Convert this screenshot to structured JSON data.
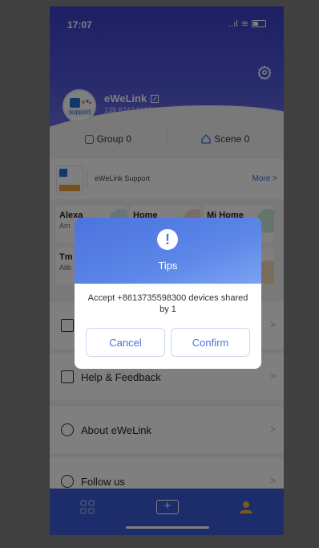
{
  "status": {
    "time": "17:07",
    "signal": "..ıl",
    "wifi": "≋"
  },
  "profile": {
    "name": "eWeLink",
    "phone": "139 6747 9150",
    "avatar_text": "support"
  },
  "group_scene": {
    "group_label": "Group 0",
    "scene_label": "Scene 0"
  },
  "support": {
    "name": "eWeLink Support",
    "more_label": "More >"
  },
  "cards": [
    {
      "title": "Alexa",
      "subtitle": "Am"
    },
    {
      "title": "Home",
      "subtitle": ""
    },
    {
      "title": "Mi Home",
      "subtitle": ""
    },
    {
      "title": "Tm",
      "subtitle": "Alib"
    }
  ],
  "menu": {
    "help": "Help & Feedback",
    "about": "About eWeLink",
    "follow": "Follow us",
    "arrow": ">"
  },
  "dialog": {
    "icon": "!",
    "title": "Tips",
    "message": "Accept +8613735598300 devices shared by 1",
    "cancel": "Cancel",
    "confirm": "Confirm"
  },
  "tabbar": {
    "add_symbol": "+"
  },
  "colors": {
    "accent": "#4b73de",
    "header": "#3a3fc6",
    "tabbar": "#3a5bd6",
    "card_deco": "#9fd1e6"
  },
  "icons": {
    "settings": "gear-icon",
    "edit": "edit-icon",
    "group": "group-icon",
    "scene": "home-icon",
    "chat": "chat-icon",
    "help": "feedback-icon",
    "about": "info-icon",
    "follow": "link-icon",
    "tab_home": "devices-icon",
    "tab_add": "add-icon",
    "tab_me": "person-icon"
  }
}
